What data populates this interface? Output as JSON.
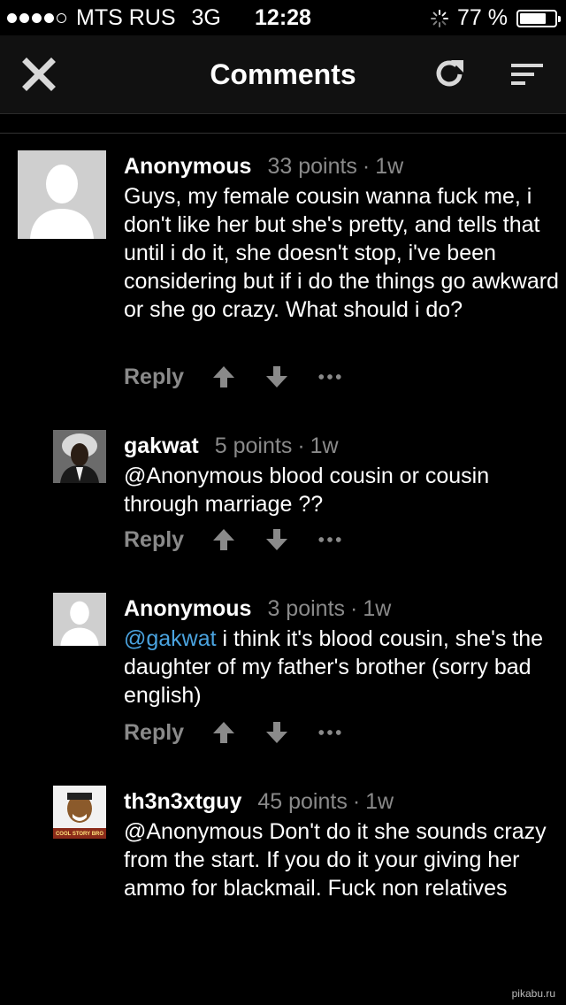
{
  "status_bar": {
    "carrier": "MTS RUS",
    "network": "3G",
    "time": "12:28",
    "battery": "77 %",
    "battery_level": 0.77,
    "signal_bars_filled": 4,
    "signal_bars_total": 5
  },
  "nav": {
    "title": "Comments",
    "close_icon": "close-icon",
    "refresh_icon": "refresh-icon",
    "sort_icon": "sort-icon"
  },
  "comments": [
    {
      "username": "Anonymous",
      "points": "33 points",
      "separator": "·",
      "age": "1w",
      "body": "Guys, my female cousin wanna fuck me, i don't like her but she's pretty, and tells that until i do it, she doesn't stop, i've been considering but if i do the things go awkward or she go crazy. What should i do?",
      "reply_label": "Reply"
    },
    {
      "username": "gakwat",
      "points": "5 points",
      "separator": "·",
      "age": "1w",
      "body": "@Anonymous  blood cousin or cousin through marriage ??",
      "reply_label": "Reply"
    },
    {
      "username": "Anonymous",
      "points": "3 points",
      "separator": "·",
      "age": "1w",
      "mention": "@gakwat",
      "body": " i think it's blood cousin, she's the daughter of my father's brother (sorry bad english)",
      "reply_label": "Reply"
    },
    {
      "username": "th3n3xtguy",
      "points": "45 points",
      "separator": "·",
      "age": "1w",
      "body": "@Anonymous Don't do it she sounds crazy from the start. If you do it your giving her ammo for blackmail. Fuck non relatives",
      "avatar_caption": "COOL STORY BRO"
    }
  ],
  "icons": {
    "upvote": "arrow-up-icon",
    "downvote": "arrow-down-icon",
    "more": "more-dots-icon"
  },
  "colors": {
    "background": "#000000",
    "navbar": "#111111",
    "meta_gray": "#8a8a8a",
    "mention_blue": "#4aa3df"
  },
  "watermark": "pikabu.ru"
}
